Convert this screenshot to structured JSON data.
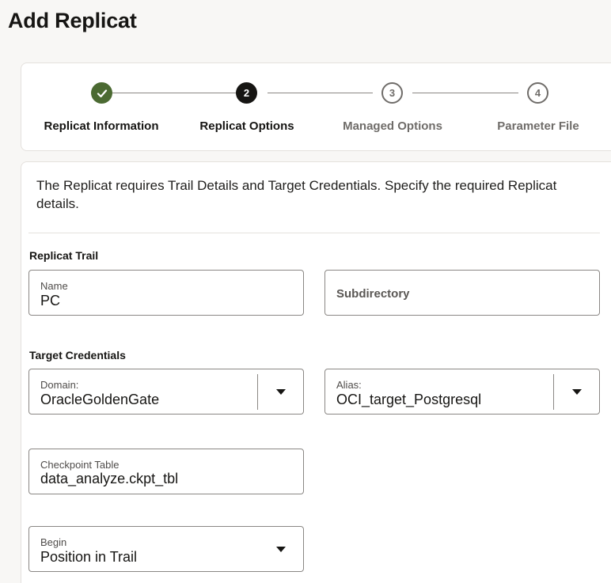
{
  "page": {
    "title": "Add Replicat"
  },
  "steps": [
    {
      "number": "",
      "label": "Replicat Information",
      "state": "done",
      "icon": "check-icon"
    },
    {
      "number": "2",
      "label": "Replicat Options",
      "state": "active"
    },
    {
      "number": "3",
      "label": "Managed Options",
      "state": "pending"
    },
    {
      "number": "4",
      "label": "Parameter File",
      "state": "pending"
    }
  ],
  "intro": "The Replicat requires Trail Details and Target Credentials. Specify the required Replicat details.",
  "replicat_trail": {
    "section_label": "Replicat Trail",
    "name": {
      "label": "Name",
      "value": "PC"
    },
    "subdirectory": {
      "placeholder": "Subdirectory"
    }
  },
  "target_credentials": {
    "section_label": "Target Credentials",
    "domain": {
      "label": "Domain:",
      "value": "OracleGoldenGate"
    },
    "alias": {
      "label": "Alias:",
      "value": "OCI_target_Postgresql"
    }
  },
  "checkpoint_table": {
    "label": "Checkpoint Table",
    "value": "data_analyze.ckpt_tbl"
  },
  "begin": {
    "label": "Begin",
    "value": "Position in Trail"
  },
  "colors": {
    "step_done": "#4b6a32",
    "step_active": "#161513",
    "step_pending": "#6f6c69",
    "field_border": "#8a8784"
  }
}
